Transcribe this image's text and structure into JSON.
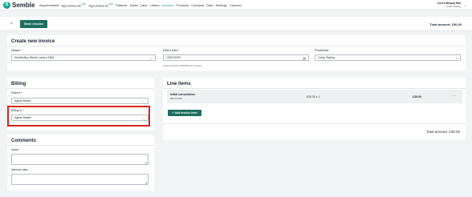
{
  "brand": {
    "name": "Semble",
    "logo_icon": "semble-logo-icon"
  },
  "nav": {
    "items": [
      {
        "label": "Appointments",
        "badge": ""
      },
      {
        "label": "Appointments",
        "badge": "NEW"
      },
      {
        "label": "Appointments",
        "badge": "NEW"
      },
      {
        "label": "Patients",
        "badge": ""
      },
      {
        "label": "Tasks",
        "badge": ""
      },
      {
        "label": "Labs",
        "badge": ""
      },
      {
        "label": "Letters",
        "badge": ""
      },
      {
        "label": "Invoices",
        "badge": ""
      },
      {
        "label": "Products",
        "badge": ""
      },
      {
        "label": "Contacts",
        "badge": ""
      },
      {
        "label": "Data",
        "badge": ""
      },
      {
        "label": "Settings",
        "badge": ""
      },
      {
        "label": "Connect",
        "badge": ""
      }
    ],
    "active_index": 7,
    "accent_color": "#17a98e"
  },
  "account": {
    "name": "Cori's Beauty Bar",
    "user": "Cindy Testing"
  },
  "toolbar": {
    "back_symbol": "×",
    "save_label": "Save invoice",
    "total_label": "Total amount: £30.00"
  },
  "create": {
    "title": "Create new invoice",
    "header_label": "Header *",
    "header_value": "Northbolton Street London NW1",
    "date_label": "Select Date *",
    "date_value": "13/07/2025",
    "date_hint": "Invoices before 03/03/25 are locked",
    "practitioner_label": "Practitioner",
    "practitioner_value": "Cindy Testing"
  },
  "billing": {
    "title": "Billing",
    "patient_label": "Patient *",
    "patient_value": "Agnes Martin",
    "billing_to_label": "Billing to *",
    "billing_to_value": "Agnes Martin"
  },
  "comments": {
    "title": "Comments",
    "notes_label": "Notes",
    "internal_label": "Internal notes"
  },
  "line_items": {
    "title": "Line items",
    "items": [
      {
        "name": "Initial consultation",
        "date": "08/07/2025",
        "qty": "£30.00 x 1",
        "amount": "£30.00"
      }
    ],
    "add_label": "Add invoice item",
    "total_label": "Total amount: £30.00"
  },
  "colors": {
    "primary_button": "#1f6e60",
    "highlight": "#d9251c"
  }
}
